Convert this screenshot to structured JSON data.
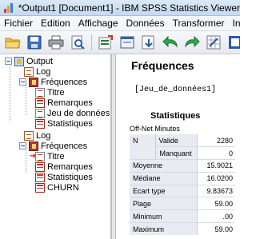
{
  "window": {
    "title": "*Output1 [Document1] - IBM SPSS Statistics Viewer"
  },
  "menu": {
    "items": [
      {
        "label": "Fichier",
        "name": "menu-fichier"
      },
      {
        "label": "Edition",
        "name": "menu-edition"
      },
      {
        "label": "Affichage",
        "name": "menu-affichage"
      },
      {
        "label": "Données",
        "name": "menu-donnees"
      },
      {
        "label": "Transformer",
        "name": "menu-transformer"
      },
      {
        "label": "Insére",
        "name": "menu-inserer"
      }
    ]
  },
  "toolbar": {
    "buttons": [
      "open-folder-icon",
      "save-icon",
      "print-icon",
      "print-preview-icon",
      "export-icon",
      "recall-dialog-icon",
      "import-data-icon",
      "undo-icon",
      "redo-icon",
      "goto-data-icon",
      "goto-case-icon"
    ]
  },
  "tree": {
    "items": [
      {
        "label": "Output",
        "icon": "output-icon"
      },
      {
        "label": "Log",
        "icon": "log-icon"
      },
      {
        "label": "Fréquences",
        "icon": "book-icon"
      },
      {
        "label": "Titre",
        "icon": "page-icon"
      },
      {
        "label": "Remarques",
        "icon": "table-icon"
      },
      {
        "label": "Jeu de données a",
        "icon": "page-icon"
      },
      {
        "label": "Statistiques",
        "icon": "table-icon"
      },
      {
        "label": "Log",
        "icon": "log-icon"
      },
      {
        "label": "Fréquences",
        "icon": "book-icon"
      },
      {
        "label": "Titre",
        "icon": "page-icon",
        "selected_arrow": true
      },
      {
        "label": "Remarques",
        "icon": "table-icon"
      },
      {
        "label": "Statistiques",
        "icon": "table-icon"
      },
      {
        "label": "CHURN",
        "icon": "table-icon"
      }
    ]
  },
  "content": {
    "heading": "Fréquences",
    "dataset": "[Jeu_de_données1]",
    "stats_title": "Statistiques",
    "variable": "Off-Net Minutes",
    "rows": [
      {
        "label": "N",
        "sublabel": "Valide",
        "value": "2280"
      },
      {
        "label": "",
        "sublabel": "Manquant",
        "value": "0"
      },
      {
        "label": "Moyenne",
        "sublabel": "",
        "value": "15.9021"
      },
      {
        "label": "Médiane",
        "sublabel": "",
        "value": "16.0200"
      },
      {
        "label": "Ecart type",
        "sublabel": "",
        "value": "9.83673"
      },
      {
        "label": "Plage",
        "sublabel": "",
        "value": "59.00"
      },
      {
        "label": "Minimum",
        "sublabel": "",
        "value": ".00"
      },
      {
        "label": "Maximum",
        "sublabel": "",
        "value": "59.00"
      }
    ]
  }
}
